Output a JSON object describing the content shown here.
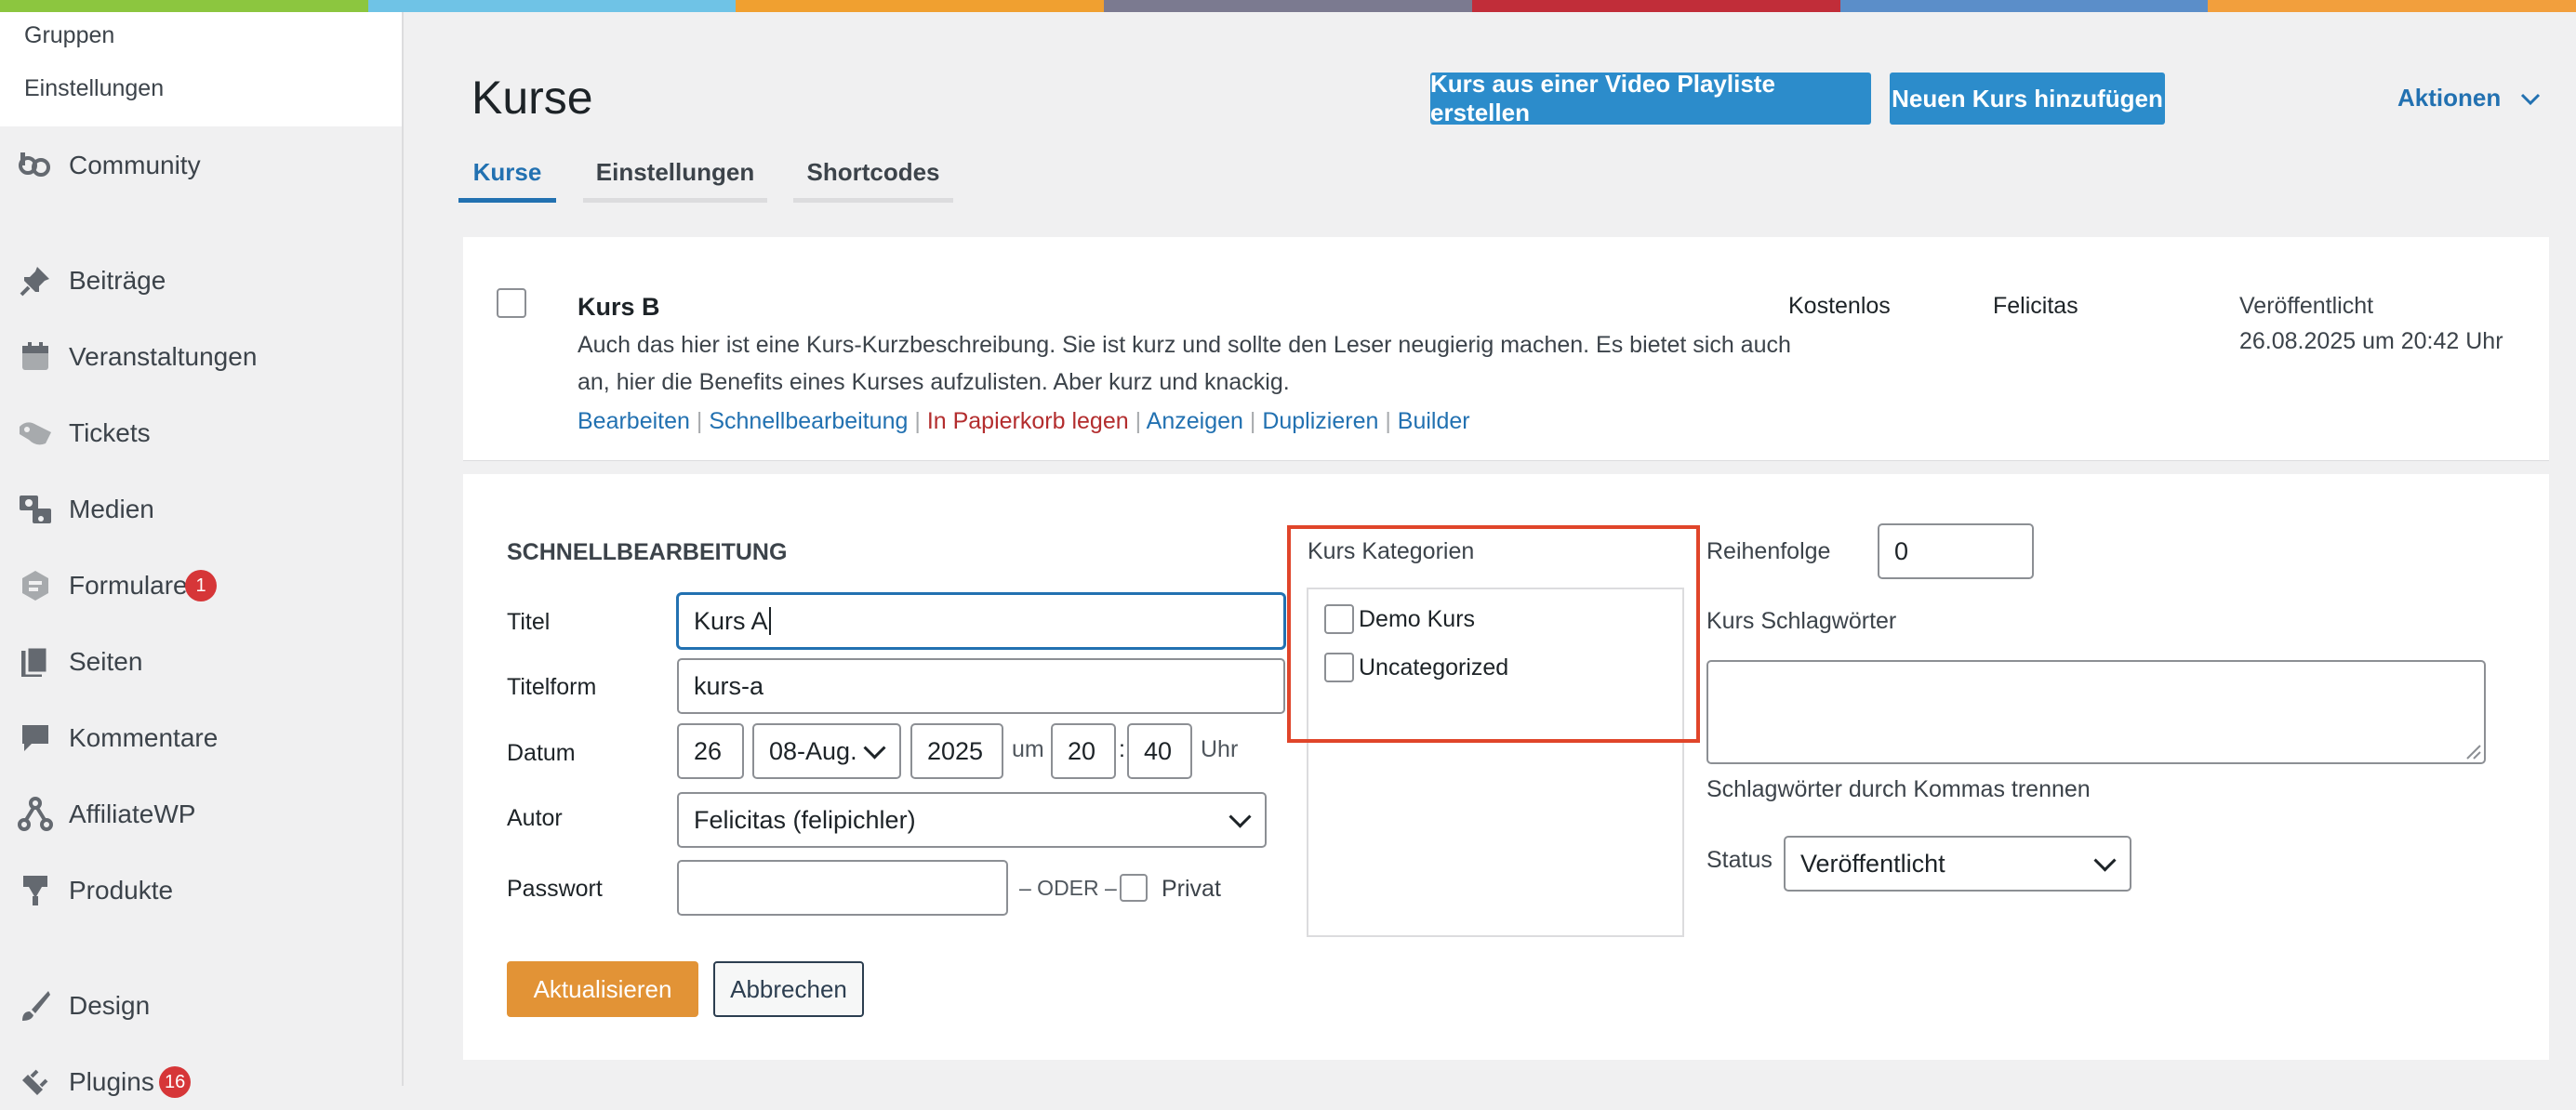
{
  "stripe_colors": [
    "#8cc63f",
    "#6fc3e6",
    "#f0a030",
    "#7b7a90",
    "#c12d39",
    "#5b8ec9",
    "#f29f3d"
  ],
  "sidebar": {
    "sub_items": [
      {
        "label": "Gruppen"
      },
      {
        "label": "Einstellungen"
      }
    ],
    "items": [
      {
        "label": "Community",
        "icon": "community-icon"
      },
      {
        "label": "Beiträge",
        "icon": "pin-icon"
      },
      {
        "label": "Veranstaltungen",
        "icon": "calendar-icon"
      },
      {
        "label": "Tickets",
        "icon": "ticket-icon"
      },
      {
        "label": "Medien",
        "icon": "media-icon"
      },
      {
        "label": "Formulare",
        "icon": "forms-icon",
        "badge": "1"
      },
      {
        "label": "Seiten",
        "icon": "pages-icon"
      },
      {
        "label": "Kommentare",
        "icon": "comment-icon"
      },
      {
        "label": "AffiliateWP",
        "icon": "affiliate-icon"
      },
      {
        "label": "Produkte",
        "icon": "download-icon"
      },
      {
        "label": "Design",
        "icon": "brush-icon"
      },
      {
        "label": "Plugins",
        "icon": "plugin-icon",
        "badge": "16"
      }
    ]
  },
  "header": {
    "title": "Kurse",
    "btn_playlist": "Kurs aus einer Video Playliste erstellen",
    "btn_new": "Neuen Kurs hinzufügen",
    "actions": "Aktionen"
  },
  "tabs": [
    {
      "label": "Kurse"
    },
    {
      "label": "Einstellungen"
    },
    {
      "label": "Shortcodes"
    }
  ],
  "course_row": {
    "title": "Kurs B",
    "description_1": "Auch das hier ist eine Kurs-Kurzbeschreibung. Sie ist kurz und sollte den Leser neugierig machen. Es bietet sich auch",
    "description_2": "an, hier die Benefits eines Kurses aufzulisten. Aber kurz und knackig.",
    "actions": {
      "edit": "Bearbeiten",
      "quick": "Schnellbearbeitung",
      "trash": "In Papierkorb legen",
      "view": "Anzeigen",
      "duplicate": "Duplizieren",
      "builder": "Builder"
    },
    "price": "Kostenlos",
    "author": "Felicitas",
    "status": "Veröffentlicht",
    "date": "26.08.2025 um 20:42 Uhr"
  },
  "quick_edit": {
    "heading": "SCHNELLBEARBEITUNG",
    "title_label": "Titel",
    "title_value": "Kurs A",
    "slug_label": "Titelform",
    "slug_value": "kurs-a",
    "date_label": "Datum",
    "day": "26",
    "month": "08-Aug.",
    "year": "2025",
    "at": "um",
    "hour": "20",
    "colon": ":",
    "minute": "40",
    "uhr": "Uhr",
    "author_label": "Autor",
    "author_value": "Felicitas (felipichler)",
    "password_label": "Passwort",
    "password_value": "",
    "oder": "– ODER –",
    "private_label": "Privat",
    "categories_label": "Kurs Kategorien",
    "categories": [
      {
        "label": "Demo Kurs"
      },
      {
        "label": "Uncategorized"
      }
    ],
    "order_label": "Reihenfolge",
    "order_value": "0",
    "tags_label": "Kurs Schlagwörter",
    "tags_hint": "Schlagwörter durch Kommas trennen",
    "status_label": "Status",
    "status_value": "Veröffentlicht",
    "update_btn": "Aktualisieren",
    "cancel_btn": "Abbrechen"
  }
}
